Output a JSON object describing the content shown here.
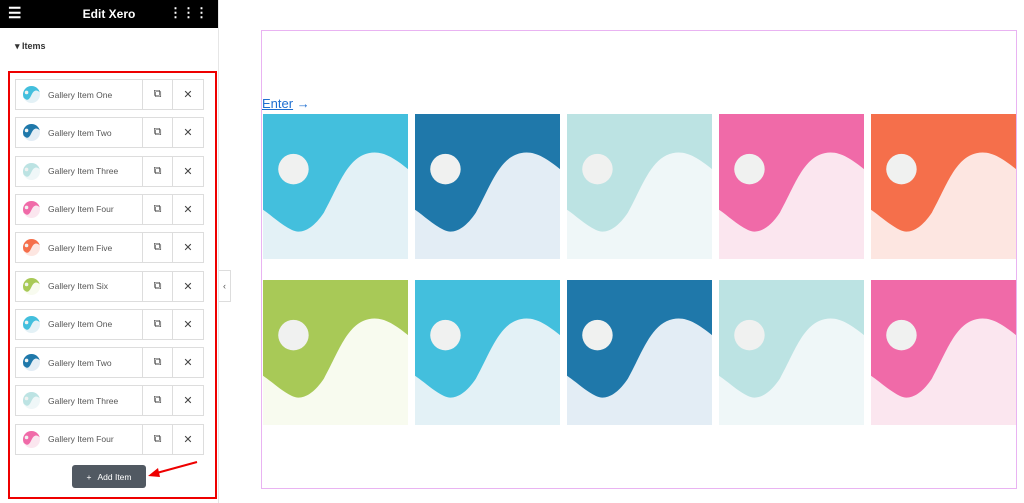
{
  "header": {
    "title": "Edit Xero",
    "menu_icon": "hamburger-icon",
    "apps_icon": "grid-icon"
  },
  "section": {
    "title": "Items"
  },
  "items": [
    {
      "label": "Gallery Item One",
      "color": "#43bfdd",
      "light": "#e3f1f6"
    },
    {
      "label": "Gallery Item Two",
      "color": "#1f78aa",
      "light": "#e3edf5"
    },
    {
      "label": "Gallery Item Three",
      "color": "#bce3e3",
      "light": "#eff7f8"
    },
    {
      "label": "Gallery Item Four",
      "color": "#f06aa8",
      "light": "#fbe6ef"
    },
    {
      "label": "Gallery Item Five",
      "color": "#f56f4b",
      "light": "#fde6e1"
    },
    {
      "label": "Gallery Item Six",
      "color": "#a8c957",
      "light": "#f8fbef"
    },
    {
      "label": "Gallery Item One",
      "color": "#43bfdd",
      "light": "#e3f1f6"
    },
    {
      "label": "Gallery Item Two",
      "color": "#1f78aa",
      "light": "#e3edf5"
    },
    {
      "label": "Gallery Item Three",
      "color": "#bce3e3",
      "light": "#eff7f8"
    },
    {
      "label": "Gallery Item Four",
      "color": "#f06aa8",
      "light": "#fbe6ef"
    }
  ],
  "add_button": {
    "label": "Add Item"
  },
  "preview": {
    "link_text": "Enter",
    "link_arrow": "→",
    "tiles": [
      {
        "color": "#43bfdd",
        "light": "#e3f1f6"
      },
      {
        "color": "#1f78aa",
        "light": "#e3edf5"
      },
      {
        "color": "#bce3e3",
        "light": "#eff7f8"
      },
      {
        "color": "#f06aa8",
        "light": "#fbe6ef"
      },
      {
        "color": "#f56f4b",
        "light": "#fde6e1"
      },
      {
        "color": "#a8c957",
        "light": "#f8fbef"
      },
      {
        "color": "#43bfdd",
        "light": "#e3f1f6"
      },
      {
        "color": "#1f78aa",
        "light": "#e3edf5"
      },
      {
        "color": "#bce3e3",
        "light": "#eff7f8"
      },
      {
        "color": "#f06aa8",
        "light": "#fbe6ef"
      }
    ]
  },
  "highlight_color": "#ee0000"
}
